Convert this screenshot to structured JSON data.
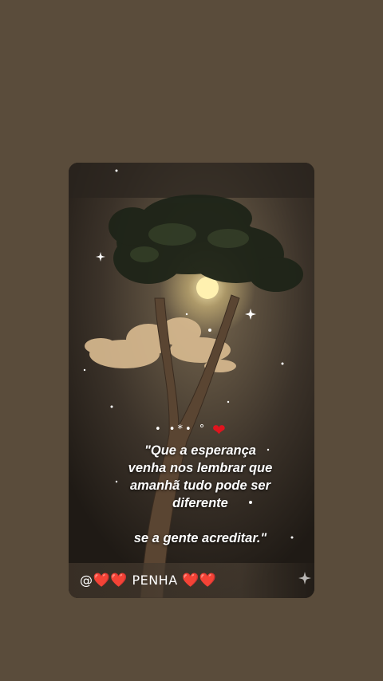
{
  "quote": {
    "ornament": "• •*• °",
    "line1": "\"Que a esperança",
    "line2": "venha nos lembrar que",
    "line3": "amanhã tudo pode ser",
    "line4": "diferente",
    "line5": "se a gente acreditar.\""
  },
  "footer": {
    "prefix": "@",
    "name": "PENHA"
  },
  "colors": {
    "background": "#5a4c3b",
    "heart": "#e0141e",
    "text": "#ffffff"
  },
  "icons": [
    "heart-icon",
    "sparkle-icon",
    "moon",
    "tree",
    "cloud"
  ]
}
